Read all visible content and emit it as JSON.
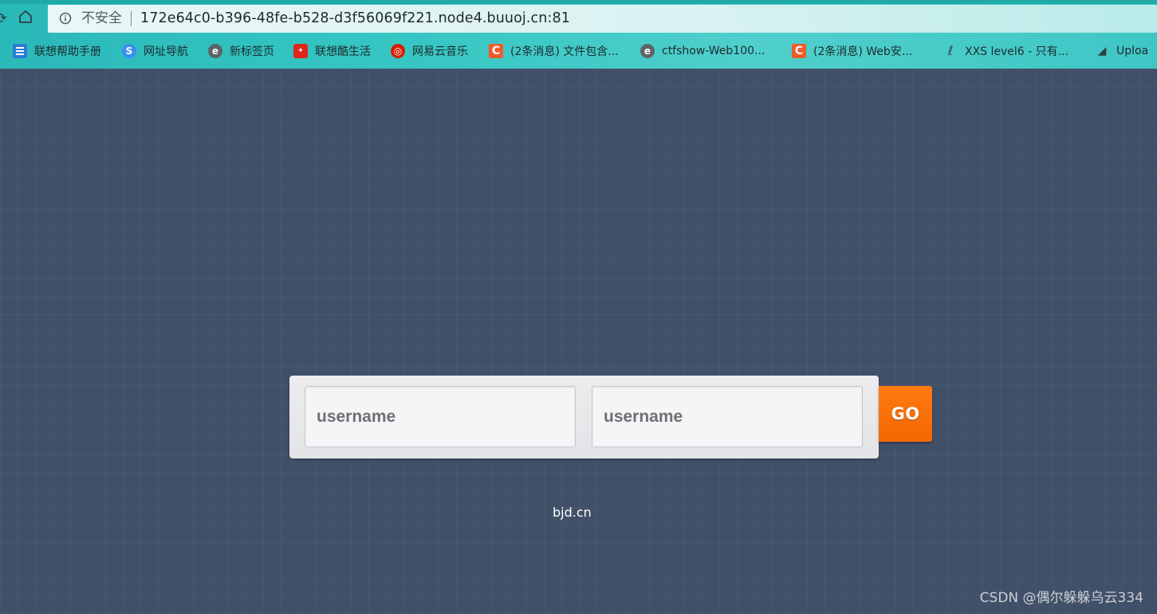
{
  "browser": {
    "address_bar": {
      "security_label": "不安全",
      "url": "172e64c0-b396-48fe-b528-d3f56069f221.node4.buuoj.cn:81"
    },
    "bookmarks": [
      {
        "label": "联想帮助手册",
        "icon": "doc-icon"
      },
      {
        "label": "网址导航",
        "icon": "navigation-icon"
      },
      {
        "label": "新标签页",
        "icon": "e-browser-icon"
      },
      {
        "label": "联想酷生活",
        "icon": "lenovo-life-icon"
      },
      {
        "label": "网易云音乐",
        "icon": "netease-music-icon"
      },
      {
        "label": "(2条消息) 文件包含...",
        "icon": "csdn-icon"
      },
      {
        "label": "ctfshow-Web100...",
        "icon": "e-browser-icon"
      },
      {
        "label": "(2条消息) Web安...",
        "icon": "csdn-icon"
      },
      {
        "label": "XXS level6 - 只有...",
        "icon": "xxs-icon"
      },
      {
        "label": "Uploa",
        "icon": "upload-icon"
      }
    ]
  },
  "form": {
    "field1_placeholder": "username",
    "field2_placeholder": "username",
    "go_label": "GO",
    "accent_color": "#ff6d00"
  },
  "footer": {
    "link_text": "bjd.cn"
  },
  "watermark": {
    "text": "CSDN @偶尔躲躲乌云334"
  }
}
